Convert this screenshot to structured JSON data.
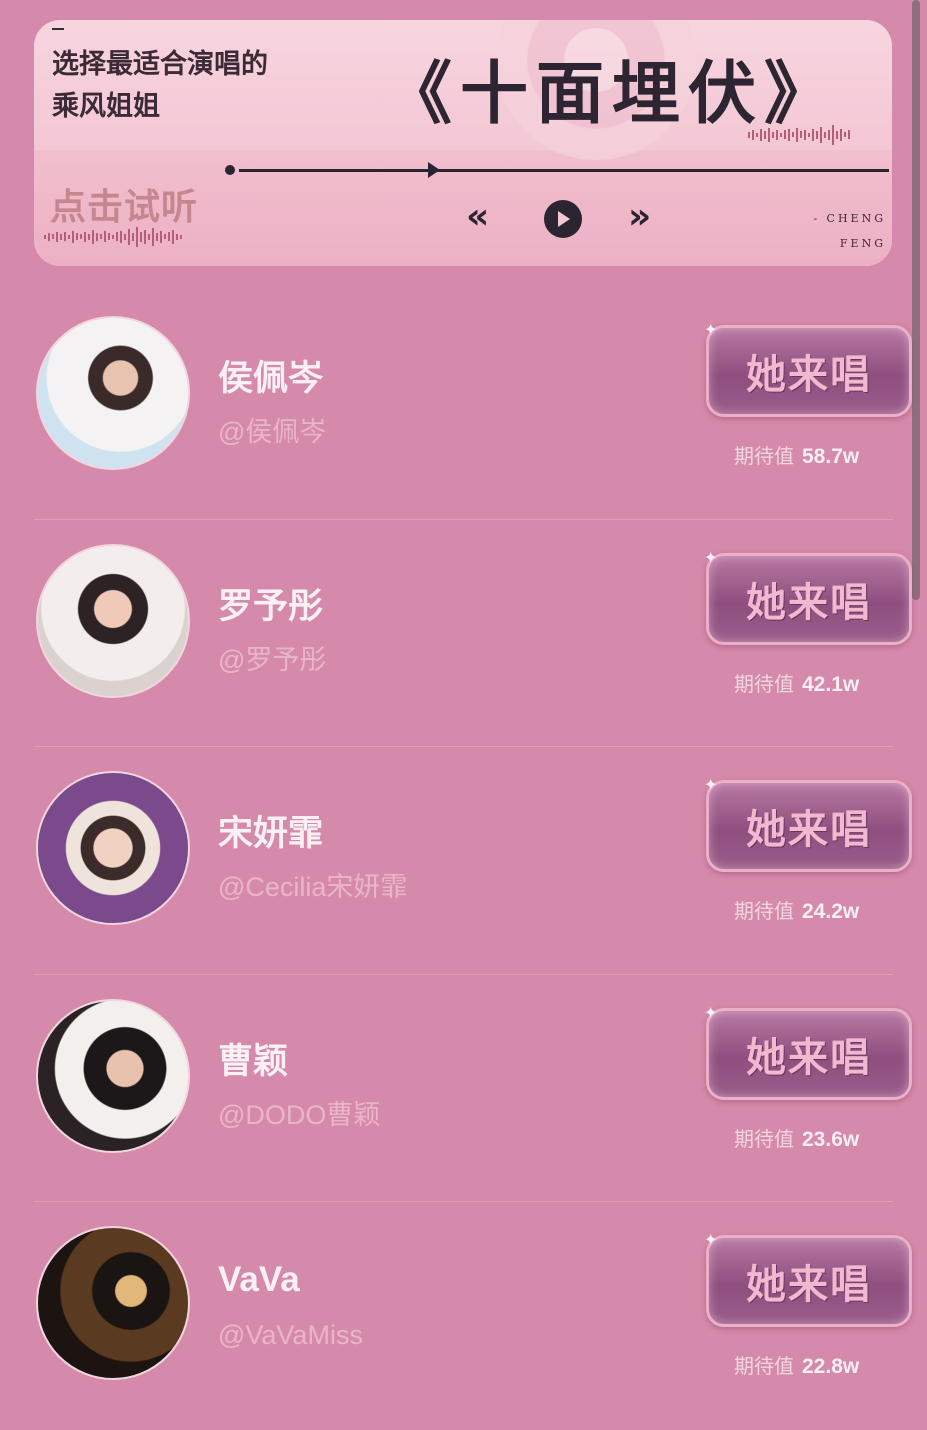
{
  "banner": {
    "subtitle": "选择最适合演唱的\n乘风姐姐",
    "song_title": "《十面埋伏》",
    "listen_label": "点击试听",
    "brand_line1": "- CHENG",
    "brand_line2": "FENG",
    "controls": {
      "rewind_icon": "«",
      "forward_icon": "»"
    },
    "playback_progress": 0.3
  },
  "contestants": [
    {
      "name": "侯佩岑",
      "handle": "@侯佩岑",
      "vote_label": "她来唱",
      "expect_label": "期待值",
      "expect_value": "58.7w"
    },
    {
      "name": "罗予彤",
      "handle": "@罗予彤",
      "vote_label": "她来唱",
      "expect_label": "期待值",
      "expect_value": "42.1w"
    },
    {
      "name": "宋妍霏",
      "handle": "@Cecilia宋妍霏",
      "vote_label": "她来唱",
      "expect_label": "期待值",
      "expect_value": "24.2w"
    },
    {
      "name": "曹颖",
      "handle": "@DODO曹颖",
      "vote_label": "她来唱",
      "expect_label": "期待值",
      "expect_value": "23.6w"
    },
    {
      "name": "VaVa",
      "handle": "@VaVaMiss",
      "vote_label": "她来唱",
      "expect_label": "期待值",
      "expect_value": "22.8w"
    }
  ],
  "colors": {
    "background": "#d68aab",
    "banner": "#f3c6d4",
    "button": "#8e4f7f",
    "button_text": "#f1b9cf",
    "name_text": "#fbf1f4"
  }
}
